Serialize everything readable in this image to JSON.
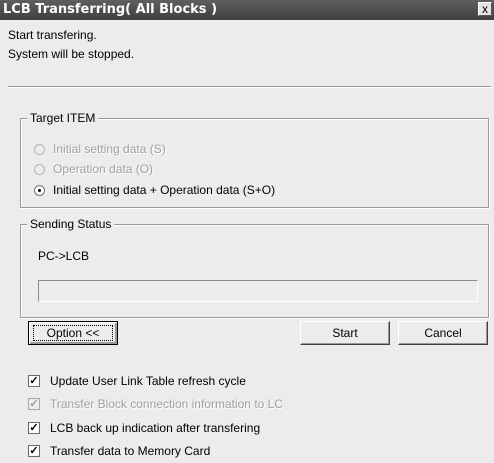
{
  "window": {
    "title": "LCB Transferring( All Blocks )",
    "close_glyph": "x"
  },
  "messages": {
    "line1": "Start transfering.",
    "line2": "System will be stopped."
  },
  "target_item": {
    "title": "Target ITEM",
    "options": [
      {
        "label": "Initial setting data (S)",
        "selected": false,
        "enabled": false
      },
      {
        "label": "Operation data (O)",
        "selected": false,
        "enabled": false
      },
      {
        "label": "Initial setting data + Operation data (S+O)",
        "selected": true,
        "enabled": true
      }
    ]
  },
  "sending_status": {
    "title": "Sending Status",
    "direction": "PC->LCB",
    "progress_fraction": 0
  },
  "buttons": {
    "option": "Option <<",
    "start": "Start",
    "cancel": "Cancel"
  },
  "checkboxes": [
    {
      "label": "Update User Link Table refresh cycle",
      "checked": true,
      "enabled": true
    },
    {
      "label": "Transfer Block connection information to LC",
      "checked": true,
      "enabled": false
    },
    {
      "label": "LCB back up indication after transfering",
      "checked": true,
      "enabled": true
    },
    {
      "label": "Transfer data to Memory Card",
      "checked": true,
      "enabled": true
    }
  ]
}
